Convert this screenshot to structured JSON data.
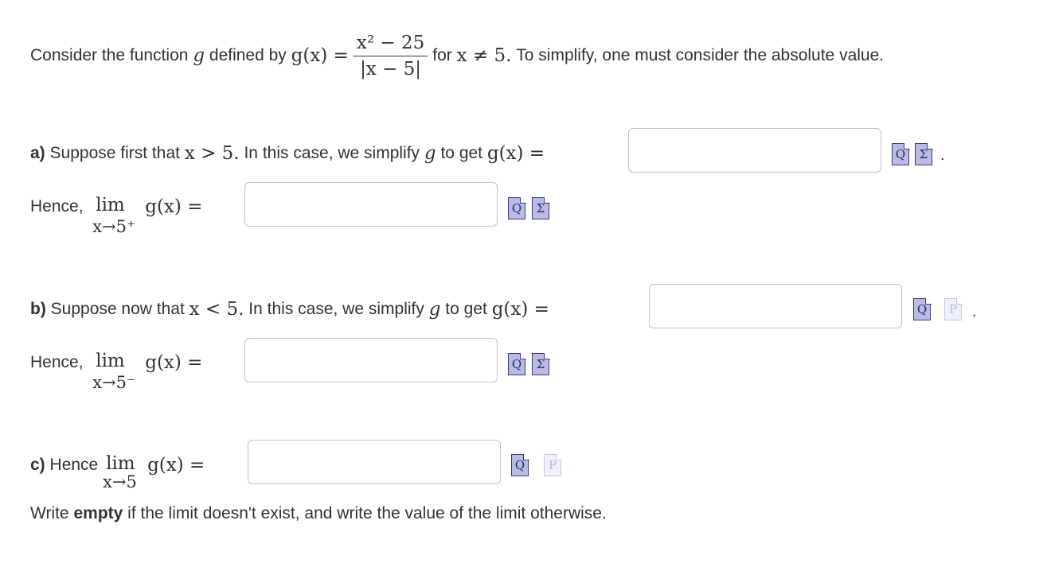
{
  "intro": {
    "prefix": "Consider the function",
    "g": "g",
    "defined_by": "defined by",
    "lhs": "g(x) =",
    "numerator": "x² − 25",
    "denominator": "|x − 5|",
    "for_text": "for",
    "condition": "x ≠ 5.",
    "suffix": "To simplify, one must consider the absolute value."
  },
  "part_a": {
    "label": "a)",
    "text1": "Suppose first that",
    "condition": "x > 5.",
    "text2": "In this case, we simplify",
    "g": "g",
    "text3": "to get",
    "rhs": "g(x) =",
    "input_value": "",
    "hence": "Hence,",
    "lim": "lim",
    "lim_sub": "x→5⁺",
    "lim_func": "g(x) =",
    "limit_input_value": ""
  },
  "part_b": {
    "label": "b)",
    "text1": "Suppose now that",
    "condition": "x < 5.",
    "text2": "In this case, we simplify",
    "g": "g",
    "text3": "to get",
    "rhs": "g(x) =",
    "input_value": "",
    "hence": "Hence,",
    "lim": "lim",
    "lim_sub": "x→5⁻",
    "lim_func": "g(x) =",
    "limit_input_value": ""
  },
  "part_c": {
    "label": "c)",
    "text1": "Hence",
    "lim": "lim",
    "lim_sub": "x→5",
    "lim_func": "g(x) =",
    "input_value": "",
    "note_pre": "Write",
    "note_bold": "empty",
    "note_post": "if the limit doesn't exist, and write the value of the limit otherwise."
  },
  "icons": {
    "preview": "preview-icon",
    "equation": "equation-editor-icon",
    "sigma_glyph": "Σ",
    "preview_glyph": "Q",
    "p_glyph": "P",
    "period": "."
  },
  "colors": {
    "icon_fill": "#b9bbe6",
    "icon_border": "#3a3f74",
    "input_border": "#c4c4c4"
  }
}
